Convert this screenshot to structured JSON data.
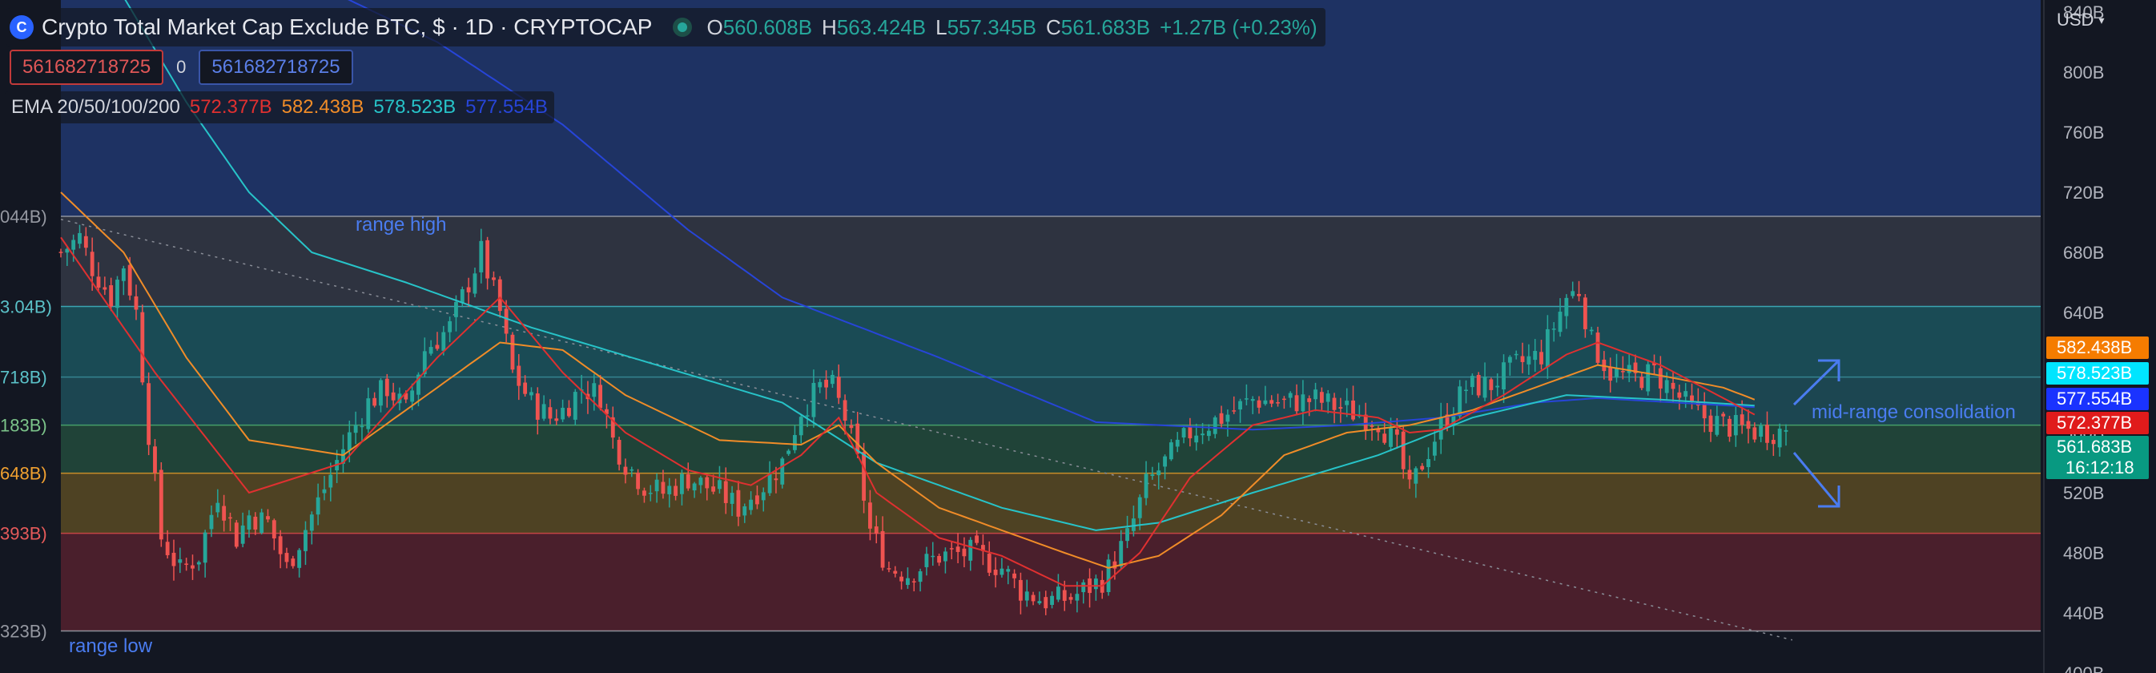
{
  "header": {
    "title": "Crypto Total Market Cap Exclude BTC, $ · 1D · CRYPTOCAP",
    "logo_glyph": "C",
    "ohlc": {
      "o_key": "O",
      "o": "560.608B",
      "h_key": "H",
      "h": "563.424B",
      "l_key": "L",
      "l": "557.345B",
      "c_key": "C",
      "c": "561.683B",
      "change": "+1.27B (+0.23%)"
    }
  },
  "symbol_row": {
    "left": "561682718725",
    "middle": "0",
    "right": "561682718725"
  },
  "indicator": {
    "label": "EMA 20/50/100/200",
    "ema20": "572.377B",
    "ema50": "582.438B",
    "ema100": "578.523B",
    "ema200": "577.554B"
  },
  "currency": "USD",
  "price_axis": {
    "ticks": [
      "840B",
      "800B",
      "760B",
      "720B",
      "680B",
      "640B",
      "600B",
      "560B",
      "520B",
      "480B",
      "440B",
      "400B"
    ],
    "tick_values": [
      840,
      800,
      760,
      720,
      680,
      640,
      600,
      560,
      520,
      480,
      440,
      400
    ]
  },
  "price_tags": [
    {
      "label": "582.438B",
      "value": 582.438,
      "color": "#f57c00"
    },
    {
      "label": "578.523B",
      "value": 578.523,
      "color": "#00e5ff"
    },
    {
      "label": "577.554B",
      "value": 577.554,
      "color": "#1a33ff"
    },
    {
      "label": "572.377B",
      "value": 572.377,
      "color": "#e01b1b"
    },
    {
      "label": "561.683B",
      "sub": "16:12:18",
      "value": 561.683,
      "color": "#089981"
    }
  ],
  "left_level_labels": [
    {
      "text": "044B)",
      "value": 704,
      "color": "#9598a1"
    },
    {
      "text": "3.04B)",
      "value": 644,
      "color": "#5bc2c9"
    },
    {
      "text": "718B)",
      "value": 597,
      "color": "#5bc2c9"
    },
    {
      "text": "183B)",
      "value": 565,
      "color": "#7cc48a"
    },
    {
      "text": "648B)",
      "value": 533,
      "color": "#f0a030"
    },
    {
      "text": "393B)",
      "value": 493,
      "color": "#e65a5a"
    },
    {
      "text": "323B)",
      "value": 428,
      "color": "#9598a1"
    }
  ],
  "annotations": {
    "range_high": "range high",
    "range_low": "range low",
    "mid_range": "mid-range consolidation"
  },
  "colors": {
    "up": "#26a69a",
    "down": "#ef5350",
    "ema20": "#e03030",
    "ema50": "#f08c28",
    "ema100": "#27c3c8",
    "ema200": "#2745d8",
    "zone_top": "#1e3263",
    "zone_grey": "#2e3340",
    "zone_teal": "#1a4b55",
    "zone_teal2": "#1c4651",
    "zone_green": "#204338",
    "zone_orange": "#4e4223",
    "zone_red": "#4a1f2c"
  },
  "chart_data": {
    "type": "candlestick",
    "y_unit": "B",
    "ylim": [
      400,
      848
    ],
    "bars": 276,
    "levels": [
      704,
      644,
      597,
      565,
      533,
      493,
      428
    ],
    "zones": [
      {
        "from": 704,
        "to": 848,
        "color_key": "zone_top"
      },
      {
        "from": 644,
        "to": 704,
        "color_key": "zone_grey"
      },
      {
        "from": 597,
        "to": 644,
        "color_key": "zone_teal"
      },
      {
        "from": 565,
        "to": 597,
        "color_key": "zone_teal2"
      },
      {
        "from": 533,
        "to": 565,
        "color_key": "zone_green"
      },
      {
        "from": 493,
        "to": 533,
        "color_key": "zone_orange"
      },
      {
        "from": 428,
        "to": 493,
        "color_key": "zone_red"
      }
    ],
    "close_anchors": [
      [
        0,
        680
      ],
      [
        3,
        690
      ],
      [
        5,
        670
      ],
      [
        8,
        650
      ],
      [
        10,
        672
      ],
      [
        12,
        640
      ],
      [
        14,
        560
      ],
      [
        16,
        490
      ],
      [
        19,
        468
      ],
      [
        22,
        478
      ],
      [
        25,
        520
      ],
      [
        28,
        490
      ],
      [
        30,
        505
      ],
      [
        33,
        500
      ],
      [
        36,
        470
      ],
      [
        40,
        505
      ],
      [
        45,
        550
      ],
      [
        49,
        580
      ],
      [
        52,
        590
      ],
      [
        55,
        575
      ],
      [
        58,
        615
      ],
      [
        62,
        630
      ],
      [
        65,
        660
      ],
      [
        67,
        680
      ],
      [
        70,
        640
      ],
      [
        72,
        600
      ],
      [
        75,
        580
      ],
      [
        78,
        570
      ],
      [
        80,
        575
      ],
      [
        83,
        590
      ],
      [
        86,
        585
      ],
      [
        88,
        555
      ],
      [
        90,
        540
      ],
      [
        93,
        525
      ],
      [
        96,
        520
      ],
      [
        100,
        530
      ],
      [
        105,
        520
      ],
      [
        108,
        510
      ],
      [
        112,
        525
      ],
      [
        115,
        540
      ],
      [
        118,
        575
      ],
      [
        121,
        590
      ],
      [
        123,
        590
      ],
      [
        125,
        570
      ],
      [
        127,
        540
      ],
      [
        129,
        495
      ],
      [
        132,
        470
      ],
      [
        135,
        466
      ],
      [
        140,
        478
      ],
      [
        145,
        480
      ],
      [
        150,
        470
      ],
      [
        153,
        455
      ],
      [
        157,
        448
      ],
      [
        161,
        450
      ],
      [
        163,
        455
      ],
      [
        166,
        462
      ],
      [
        170,
        490
      ],
      [
        173,
        525
      ],
      [
        176,
        540
      ],
      [
        180,
        560
      ],
      [
        185,
        570
      ],
      [
        190,
        582
      ],
      [
        195,
        580
      ],
      [
        200,
        582
      ],
      [
        205,
        575
      ],
      [
        210,
        568
      ],
      [
        213,
        550
      ],
      [
        215,
        520
      ],
      [
        217,
        540
      ],
      [
        220,
        565
      ],
      [
        224,
        590
      ],
      [
        228,
        592
      ],
      [
        232,
        605
      ],
      [
        236,
        612
      ],
      [
        240,
        650
      ],
      [
        242,
        655
      ],
      [
        244,
        620
      ],
      [
        247,
        600
      ],
      [
        251,
        596
      ],
      [
        254,
        600
      ],
      [
        256,
        592
      ],
      [
        260,
        575
      ],
      [
        263,
        568
      ],
      [
        267,
        563
      ],
      [
        270,
        561
      ]
    ],
    "ema20": [
      [
        0,
        690
      ],
      [
        15,
        600
      ],
      [
        30,
        520
      ],
      [
        45,
        540
      ],
      [
        60,
        610
      ],
      [
        70,
        650
      ],
      [
        80,
        600
      ],
      [
        90,
        560
      ],
      [
        100,
        535
      ],
      [
        110,
        525
      ],
      [
        118,
        545
      ],
      [
        124,
        570
      ],
      [
        130,
        520
      ],
      [
        140,
        490
      ],
      [
        150,
        478
      ],
      [
        160,
        458
      ],
      [
        166,
        458
      ],
      [
        172,
        480
      ],
      [
        180,
        530
      ],
      [
        190,
        565
      ],
      [
        200,
        575
      ],
      [
        210,
        570
      ],
      [
        215,
        560
      ],
      [
        220,
        562
      ],
      [
        230,
        585
      ],
      [
        240,
        612
      ],
      [
        245,
        620
      ],
      [
        255,
        605
      ],
      [
        265,
        583
      ],
      [
        270,
        572
      ]
    ],
    "ema50": [
      [
        0,
        720
      ],
      [
        10,
        680
      ],
      [
        20,
        610
      ],
      [
        30,
        555
      ],
      [
        45,
        545
      ],
      [
        60,
        590
      ],
      [
        70,
        620
      ],
      [
        80,
        615
      ],
      [
        90,
        585
      ],
      [
        105,
        555
      ],
      [
        118,
        552
      ],
      [
        124,
        565
      ],
      [
        130,
        540
      ],
      [
        140,
        510
      ],
      [
        150,
        495
      ],
      [
        160,
        480
      ],
      [
        167,
        470
      ],
      [
        175,
        478
      ],
      [
        185,
        505
      ],
      [
        195,
        545
      ],
      [
        205,
        560
      ],
      [
        215,
        565
      ],
      [
        225,
        575
      ],
      [
        235,
        590
      ],
      [
        245,
        605
      ],
      [
        255,
        598
      ],
      [
        265,
        590
      ],
      [
        270,
        582
      ]
    ],
    "ema100": [
      [
        10,
        850
      ],
      [
        20,
        780
      ],
      [
        30,
        720
      ],
      [
        40,
        680
      ],
      [
        55,
        660
      ],
      [
        75,
        630
      ],
      [
        95,
        605
      ],
      [
        115,
        580
      ],
      [
        130,
        540
      ],
      [
        150,
        510
      ],
      [
        165,
        495
      ],
      [
        175,
        500
      ],
      [
        190,
        520
      ],
      [
        210,
        545
      ],
      [
        225,
        570
      ],
      [
        240,
        585
      ],
      [
        255,
        582
      ],
      [
        270,
        578
      ]
    ],
    "ema200": [
      [
        45,
        850
      ],
      [
        60,
        820
      ],
      [
        80,
        765
      ],
      [
        100,
        695
      ],
      [
        115,
        650
      ],
      [
        140,
        610
      ],
      [
        165,
        567
      ],
      [
        190,
        562
      ],
      [
        205,
        565
      ],
      [
        220,
        570
      ],
      [
        235,
        580
      ],
      [
        245,
        583
      ],
      [
        270,
        577
      ]
    ],
    "trendline": {
      "from": [
        0,
        702
      ],
      "to": [
        276,
        422
      ],
      "style": "dotted"
    }
  }
}
